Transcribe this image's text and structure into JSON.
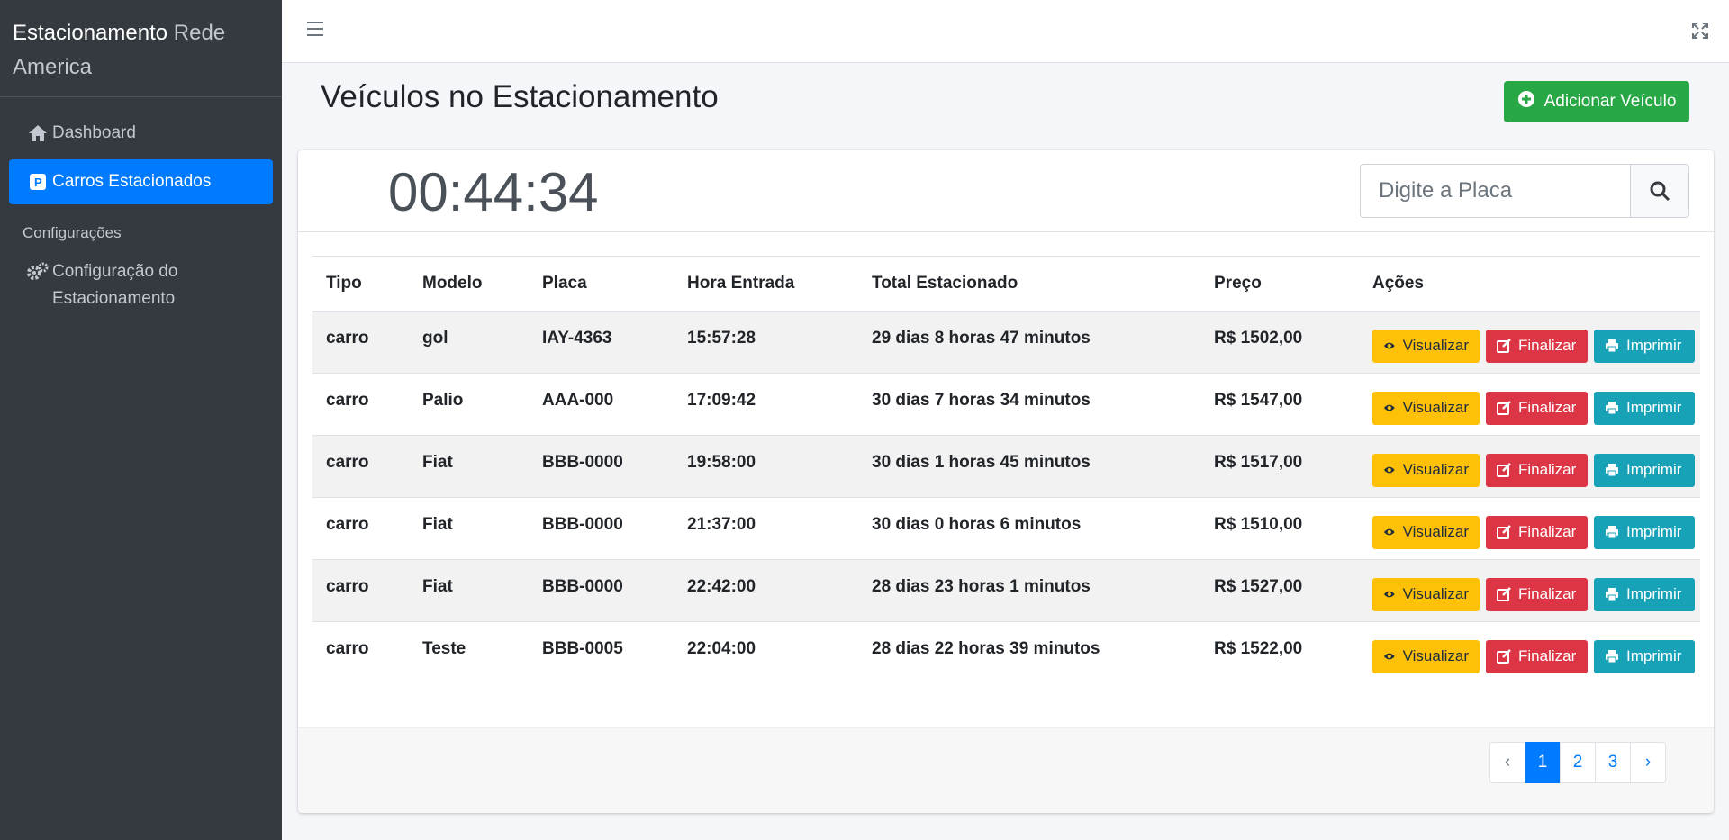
{
  "brand": {
    "name": "Estacionamento",
    "suffix": "Rede America"
  },
  "sidebar": {
    "items": [
      {
        "label": "Dashboard",
        "icon": "home-icon"
      },
      {
        "label": "Carros Estacionados",
        "icon": "parking-icon",
        "active": true
      }
    ],
    "section_header": "Configurações",
    "config_item": {
      "label_line1": "Configuração do",
      "label_line2": "Estacionamento",
      "icon": "gears-icon"
    }
  },
  "topbar": {
    "menu_icon": "hamburger-icon",
    "fullscreen_icon": "expand-icon"
  },
  "page": {
    "title": "Veículos no Estacionamento",
    "add_button": "Adicionar Veículo"
  },
  "timer": "00:44:34",
  "search": {
    "placeholder": "Digite a Placa"
  },
  "table": {
    "headers": [
      "Tipo",
      "Modelo",
      "Placa",
      "Hora Entrada",
      "Total Estacionado",
      "Preço",
      "Ações"
    ],
    "rows": [
      [
        "carro",
        "gol",
        "IAY-4363",
        "15:57:28",
        "29 dias 8 horas 47 minutos",
        "R$ 1502,00"
      ],
      [
        "carro",
        "Palio",
        "AAA-000",
        "17:09:42",
        "30 dias 7 horas 34 minutos",
        "R$ 1547,00"
      ],
      [
        "carro",
        "Fiat",
        "BBB-0000",
        "19:58:00",
        "30 dias 1 horas 45 minutos",
        "R$ 1517,00"
      ],
      [
        "carro",
        "Fiat",
        "BBB-0000",
        "21:37:00",
        "30 dias 0 horas 6 minutos",
        "R$ 1510,00"
      ],
      [
        "carro",
        "Fiat",
        "BBB-0000",
        "22:42:00",
        "28 dias 23 horas 1 minutos",
        "R$ 1527,00"
      ],
      [
        "carro",
        "Teste",
        "BBB-0005",
        "22:04:00",
        "28 dias 22 horas 39 minutos",
        "R$ 1522,00"
      ]
    ],
    "actions": {
      "view": "Visualizar",
      "finish": "Finalizar",
      "print": "Imprimir"
    }
  },
  "pagination": {
    "prev": "‹",
    "pages": [
      "1",
      "2",
      "3"
    ],
    "next": "›",
    "active": "1"
  },
  "colors": {
    "sidebar": "#343a40",
    "primary": "#007bff",
    "success": "#28a745",
    "warning": "#ffc107",
    "danger": "#dc3545",
    "info": "#17a2b8"
  }
}
